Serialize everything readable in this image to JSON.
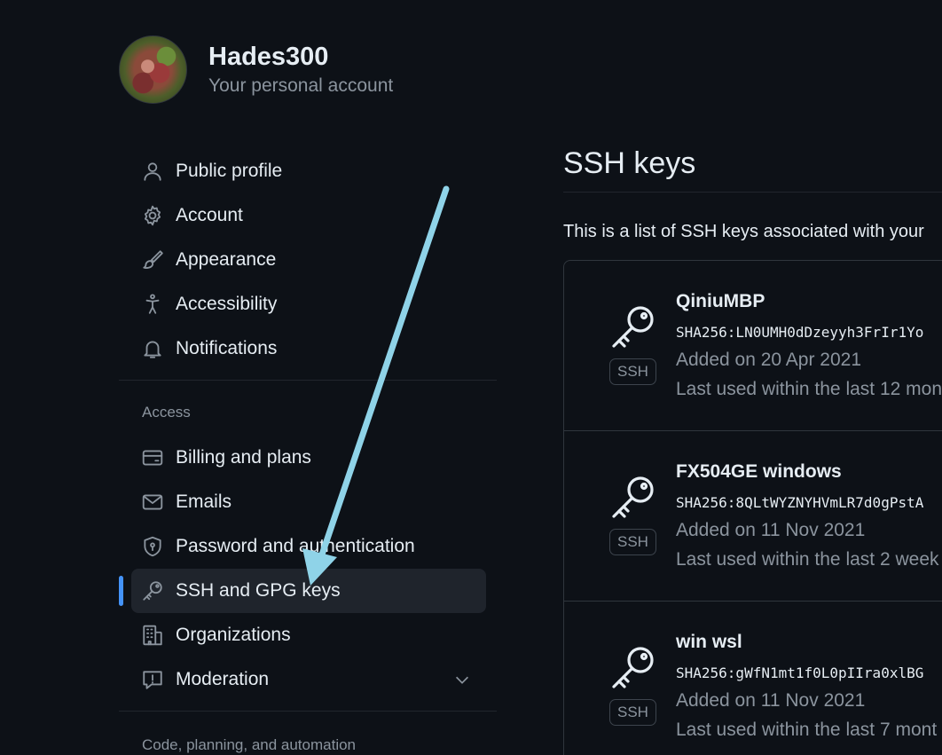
{
  "account": {
    "name": "Hades300",
    "subtitle": "Your personal account"
  },
  "sidebar": {
    "items_top": [
      {
        "label": "Public profile",
        "icon": "person-icon"
      },
      {
        "label": "Account",
        "icon": "gear-icon"
      },
      {
        "label": "Appearance",
        "icon": "paintbrush-icon"
      },
      {
        "label": "Accessibility",
        "icon": "accessibility-icon"
      },
      {
        "label": "Notifications",
        "icon": "bell-icon"
      }
    ],
    "access_label": "Access",
    "items_access": [
      {
        "label": "Billing and plans",
        "icon": "credit-card-icon"
      },
      {
        "label": "Emails",
        "icon": "mail-icon"
      },
      {
        "label": "Password and authentication",
        "icon": "shield-lock-icon"
      },
      {
        "label": "SSH and GPG keys",
        "icon": "key-icon",
        "active": true
      },
      {
        "label": "Organizations",
        "icon": "organization-icon"
      },
      {
        "label": "Moderation",
        "icon": "report-icon"
      }
    ],
    "code_label": "Code, planning, and automation"
  },
  "main": {
    "title": "SSH keys",
    "intro": "This is a list of SSH keys associated with your",
    "keys": [
      {
        "name": "QiniuMBP",
        "fingerprint": "SHA256:LN0UMH0dDzeyyh3FrIr1Yo",
        "added": "Added on 20 Apr 2021",
        "last_used": "Last used within the last 12 mon",
        "badge": "SSH"
      },
      {
        "name": "FX504GE windows",
        "fingerprint": "SHA256:8QLtWYZNYHVmLR7d0gPstA",
        "added": "Added on 11 Nov 2021",
        "last_used": "Last used within the last 2 week",
        "badge": "SSH"
      },
      {
        "name": "win wsl",
        "fingerprint": "SHA256:gWfN1mt1f0L0pIIra0xlBG",
        "added": "Added on 11 Nov 2021",
        "last_used": "Last used within the last 7 mont",
        "badge": "SSH"
      }
    ]
  },
  "colors": {
    "background": "#0d1117",
    "accent": "#4493f8",
    "arrow": "#8fd3e8"
  }
}
